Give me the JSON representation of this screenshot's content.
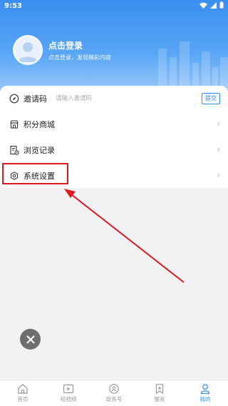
{
  "status_bar": {
    "time": "9:53"
  },
  "profile": {
    "title": "点击登录",
    "subtitle": "点击登录，发现精彩内容"
  },
  "menu": {
    "invite": {
      "label": "邀请码",
      "placeholder": "请输入邀请码",
      "submit_label": "提交"
    },
    "points_mall": {
      "label": "积分商城"
    },
    "history": {
      "label": "浏览记录"
    },
    "settings": {
      "label": "系统设置"
    }
  },
  "tabbar": {
    "items": [
      {
        "label": "首页",
        "icon": "home-icon"
      },
      {
        "label": "短视频",
        "icon": "video-icon"
      },
      {
        "label": "政务号",
        "icon": "gov-account-icon"
      },
      {
        "label": "服务",
        "icon": "bookmark-icon"
      },
      {
        "label": "我的",
        "icon": "person-icon",
        "active": true
      }
    ]
  },
  "colors": {
    "accent": "#3a8ef0",
    "annotation": "#e0191f"
  }
}
